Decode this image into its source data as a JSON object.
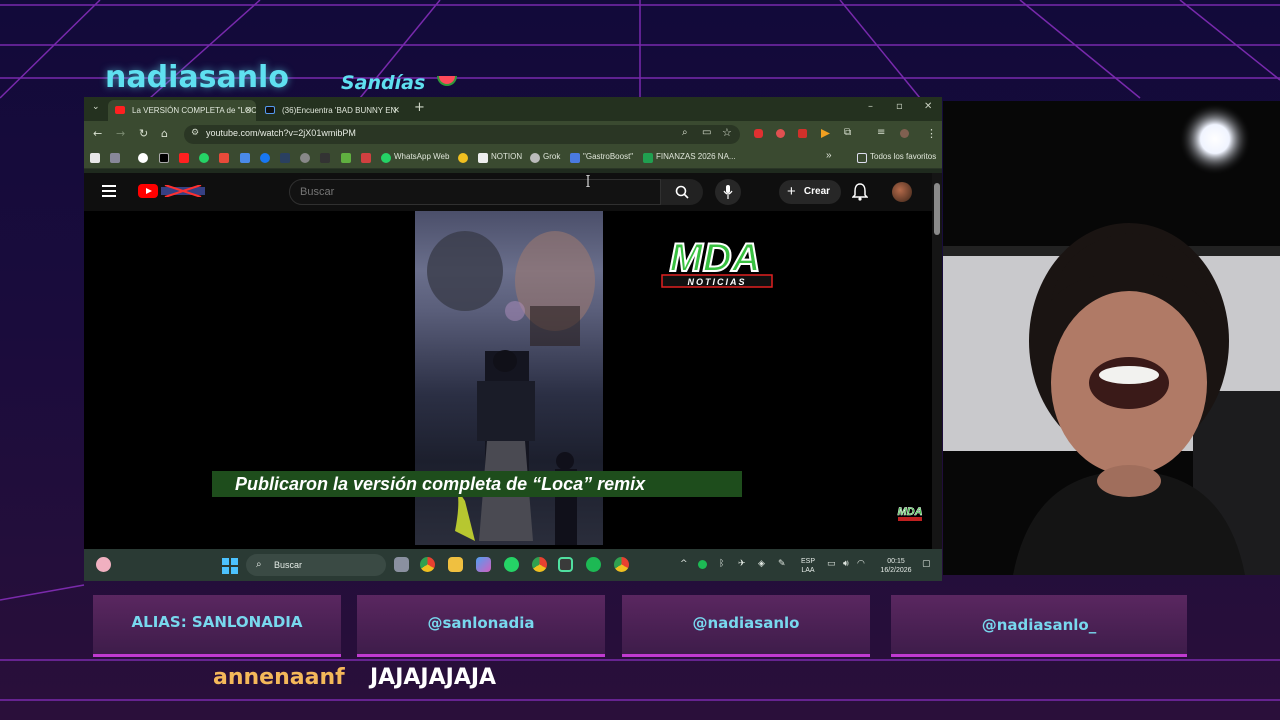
{
  "overlay": {
    "title": "nadiasanlo",
    "subtitle": "Sandías",
    "socials": [
      "ALIAS: SANLONADIA",
      "@sanlonadia",
      "@nadiasanlo",
      "@nadiasanlo_"
    ],
    "chat": {
      "user": "annenaanf",
      "message": "JAJAJAJAJA"
    },
    "colors": {
      "accent": "#5fe0f0",
      "panel": "#4a2356",
      "border": "#c03ad0",
      "chat_user": "#f4b85a"
    }
  },
  "browser": {
    "tabs": [
      {
        "label": "La VERSIÓN COMPLETA de \"LOC",
        "icon": "youtube-icon",
        "active": true
      },
      {
        "label": "(36)Encuentra 'BAD BUNNY EN",
        "icon": "tiktok-icon",
        "active": false
      }
    ],
    "url": "youtube.com/watch?v=2jX01wmibPM",
    "bookmarks": [
      "WhatsApp Web",
      "NOTION",
      "Grok",
      "\"GastroBoost\"",
      "FINANZAS 2026 NA...",
      "Todos los favoritos"
    ]
  },
  "youtube": {
    "search_placeholder": "Buscar",
    "create_label": "Crear",
    "video": {
      "caption": "Publicaron la versión completa de “Loca” remix",
      "logo_main": "MDA",
      "logo_sub": "NOTICIAS",
      "corner_logo": "MDA"
    }
  },
  "taskbar": {
    "search_label": "Buscar",
    "language_1": "ESP",
    "language_2": "LAA",
    "time": "00:15",
    "date": "16/2/2026"
  }
}
